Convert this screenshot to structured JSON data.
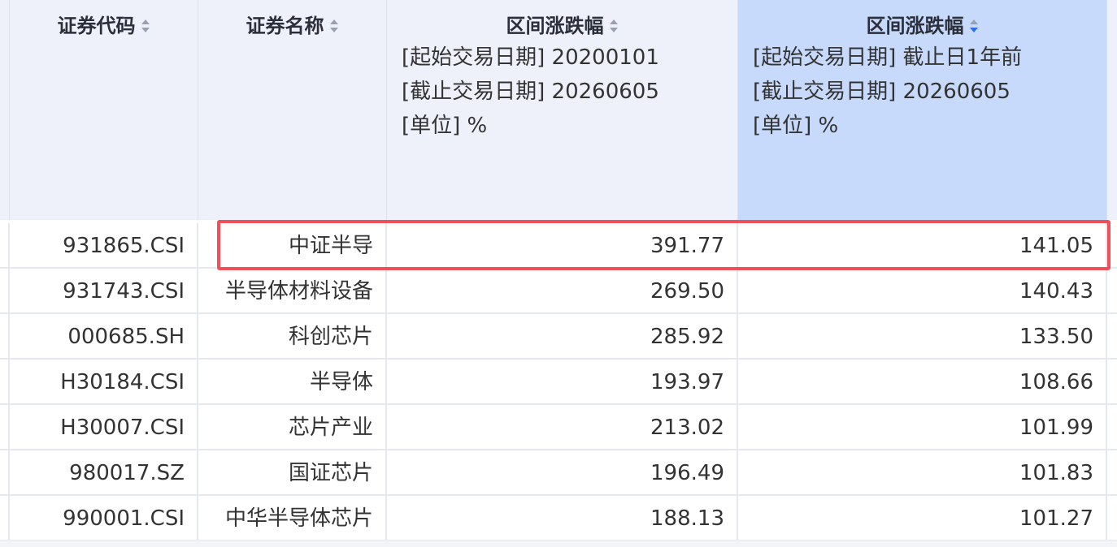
{
  "columns": [
    {
      "title": "证券代码",
      "sort": "none"
    },
    {
      "title": "证券名称",
      "sort": "none"
    },
    {
      "title": "区间涨跌幅",
      "sort": "none",
      "sub": [
        "[起始交易日期] 20200101",
        "[截止交易日期] 20260605",
        "[单位] %"
      ]
    },
    {
      "title": "区间涨跌幅",
      "sort": "desc",
      "sub": [
        "[起始交易日期] 截止日1年前",
        "[截止交易日期] 20260605",
        "[单位] %"
      ]
    }
  ],
  "rows": [
    {
      "code": "931865.CSI",
      "name": "中证半导",
      "change1": "391.77",
      "change2": "141.05"
    },
    {
      "code": "931743.CSI",
      "name": "半导体材料设备",
      "change1": "269.50",
      "change2": "140.43"
    },
    {
      "code": "000685.SH",
      "name": "科创芯片",
      "change1": "285.92",
      "change2": "133.50"
    },
    {
      "code": "H30184.CSI",
      "name": "半导体",
      "change1": "193.97",
      "change2": "108.66"
    },
    {
      "code": "H30007.CSI",
      "name": "芯片产业",
      "change1": "213.02",
      "change2": "101.99"
    },
    {
      "code": "980017.SZ",
      "name": "国证芯片",
      "change1": "196.49",
      "change2": "101.83"
    },
    {
      "code": "990001.CSI",
      "name": "中华半导体芯片",
      "change1": "188.13",
      "change2": "101.27"
    }
  ],
  "colors": {
    "header_bg": "#eef0fa",
    "sorted_header_bg": "#c7dafb",
    "sort_active": "#2f6bf0",
    "sort_inactive": "#9aa0b0",
    "highlight_border": "#f0505a"
  }
}
